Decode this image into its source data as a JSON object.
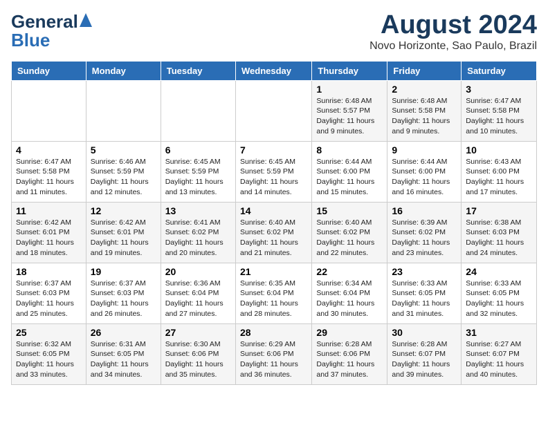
{
  "logo": {
    "line1": "General",
    "line2": "Blue"
  },
  "title": {
    "month_year": "August 2024",
    "location": "Novo Horizonte, Sao Paulo, Brazil"
  },
  "days_of_week": [
    "Sunday",
    "Monday",
    "Tuesday",
    "Wednesday",
    "Thursday",
    "Friday",
    "Saturday"
  ],
  "weeks": [
    [
      {
        "day": "",
        "info": ""
      },
      {
        "day": "",
        "info": ""
      },
      {
        "day": "",
        "info": ""
      },
      {
        "day": "",
        "info": ""
      },
      {
        "day": "1",
        "info": "Sunrise: 6:48 AM\nSunset: 5:57 PM\nDaylight: 11 hours\nand 9 minutes."
      },
      {
        "day": "2",
        "info": "Sunrise: 6:48 AM\nSunset: 5:58 PM\nDaylight: 11 hours\nand 9 minutes."
      },
      {
        "day": "3",
        "info": "Sunrise: 6:47 AM\nSunset: 5:58 PM\nDaylight: 11 hours\nand 10 minutes."
      }
    ],
    [
      {
        "day": "4",
        "info": "Sunrise: 6:47 AM\nSunset: 5:58 PM\nDaylight: 11 hours\nand 11 minutes."
      },
      {
        "day": "5",
        "info": "Sunrise: 6:46 AM\nSunset: 5:59 PM\nDaylight: 11 hours\nand 12 minutes."
      },
      {
        "day": "6",
        "info": "Sunrise: 6:45 AM\nSunset: 5:59 PM\nDaylight: 11 hours\nand 13 minutes."
      },
      {
        "day": "7",
        "info": "Sunrise: 6:45 AM\nSunset: 5:59 PM\nDaylight: 11 hours\nand 14 minutes."
      },
      {
        "day": "8",
        "info": "Sunrise: 6:44 AM\nSunset: 6:00 PM\nDaylight: 11 hours\nand 15 minutes."
      },
      {
        "day": "9",
        "info": "Sunrise: 6:44 AM\nSunset: 6:00 PM\nDaylight: 11 hours\nand 16 minutes."
      },
      {
        "day": "10",
        "info": "Sunrise: 6:43 AM\nSunset: 6:00 PM\nDaylight: 11 hours\nand 17 minutes."
      }
    ],
    [
      {
        "day": "11",
        "info": "Sunrise: 6:42 AM\nSunset: 6:01 PM\nDaylight: 11 hours\nand 18 minutes."
      },
      {
        "day": "12",
        "info": "Sunrise: 6:42 AM\nSunset: 6:01 PM\nDaylight: 11 hours\nand 19 minutes."
      },
      {
        "day": "13",
        "info": "Sunrise: 6:41 AM\nSunset: 6:02 PM\nDaylight: 11 hours\nand 20 minutes."
      },
      {
        "day": "14",
        "info": "Sunrise: 6:40 AM\nSunset: 6:02 PM\nDaylight: 11 hours\nand 21 minutes."
      },
      {
        "day": "15",
        "info": "Sunrise: 6:40 AM\nSunset: 6:02 PM\nDaylight: 11 hours\nand 22 minutes."
      },
      {
        "day": "16",
        "info": "Sunrise: 6:39 AM\nSunset: 6:02 PM\nDaylight: 11 hours\nand 23 minutes."
      },
      {
        "day": "17",
        "info": "Sunrise: 6:38 AM\nSunset: 6:03 PM\nDaylight: 11 hours\nand 24 minutes."
      }
    ],
    [
      {
        "day": "18",
        "info": "Sunrise: 6:37 AM\nSunset: 6:03 PM\nDaylight: 11 hours\nand 25 minutes."
      },
      {
        "day": "19",
        "info": "Sunrise: 6:37 AM\nSunset: 6:03 PM\nDaylight: 11 hours\nand 26 minutes."
      },
      {
        "day": "20",
        "info": "Sunrise: 6:36 AM\nSunset: 6:04 PM\nDaylight: 11 hours\nand 27 minutes."
      },
      {
        "day": "21",
        "info": "Sunrise: 6:35 AM\nSunset: 6:04 PM\nDaylight: 11 hours\nand 28 minutes."
      },
      {
        "day": "22",
        "info": "Sunrise: 6:34 AM\nSunset: 6:04 PM\nDaylight: 11 hours\nand 30 minutes."
      },
      {
        "day": "23",
        "info": "Sunrise: 6:33 AM\nSunset: 6:05 PM\nDaylight: 11 hours\nand 31 minutes."
      },
      {
        "day": "24",
        "info": "Sunrise: 6:33 AM\nSunset: 6:05 PM\nDaylight: 11 hours\nand 32 minutes."
      }
    ],
    [
      {
        "day": "25",
        "info": "Sunrise: 6:32 AM\nSunset: 6:05 PM\nDaylight: 11 hours\nand 33 minutes."
      },
      {
        "day": "26",
        "info": "Sunrise: 6:31 AM\nSunset: 6:05 PM\nDaylight: 11 hours\nand 34 minutes."
      },
      {
        "day": "27",
        "info": "Sunrise: 6:30 AM\nSunset: 6:06 PM\nDaylight: 11 hours\nand 35 minutes."
      },
      {
        "day": "28",
        "info": "Sunrise: 6:29 AM\nSunset: 6:06 PM\nDaylight: 11 hours\nand 36 minutes."
      },
      {
        "day": "29",
        "info": "Sunrise: 6:28 AM\nSunset: 6:06 PM\nDaylight: 11 hours\nand 37 minutes."
      },
      {
        "day": "30",
        "info": "Sunrise: 6:28 AM\nSunset: 6:07 PM\nDaylight: 11 hours\nand 39 minutes."
      },
      {
        "day": "31",
        "info": "Sunrise: 6:27 AM\nSunset: 6:07 PM\nDaylight: 11 hours\nand 40 minutes."
      }
    ]
  ]
}
